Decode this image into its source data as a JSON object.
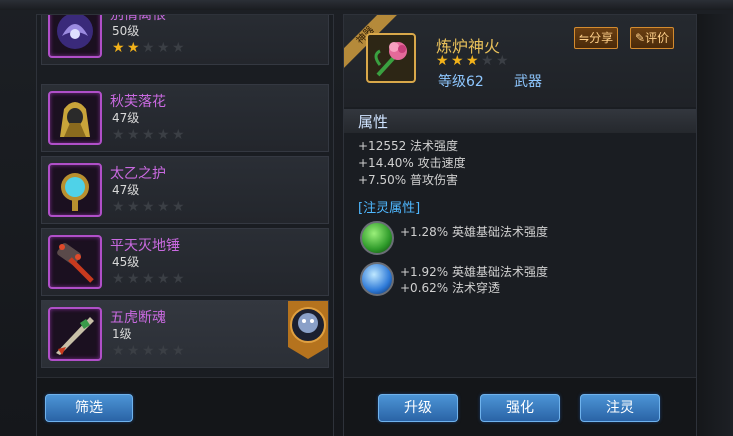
{
  "equipment_list": [
    {
      "name": "别情离恨",
      "level": "50级",
      "stars": 2,
      "icon": "purple-helmet-icon"
    },
    {
      "name": "秋芙落花",
      "level": "47级",
      "stars": 0,
      "icon": "gold-hood-icon"
    },
    {
      "name": "太乙之护",
      "level": "47级",
      "stars": 0,
      "icon": "magic-mirror-icon"
    },
    {
      "name": "平天灭地锤",
      "level": "45级",
      "stars": 0,
      "icon": "spiked-hammer-icon"
    },
    {
      "name": "五虎断魂",
      "level": "1级",
      "stars": 0,
      "icon": "tiger-blade-icon"
    }
  ],
  "filter_label": "筛选",
  "detail": {
    "corner_tag": "神器",
    "name": "炼炉神火",
    "stars": 3,
    "level": "等级62",
    "type": "武器",
    "share_label": "分享",
    "rate_label": "评价",
    "icon": "pink-flower-icon"
  },
  "attributes_header": "属性",
  "attributes": [
    "+12552 法术强度",
    "+14.40% 攻击速度",
    "+7.50% 普攻伤害"
  ],
  "spirit_header": "[注灵属性]",
  "spirit_slots": [
    {
      "gem": "green-gem-icon",
      "lines": [
        "+1.28% 英雄基础法术强度"
      ]
    },
    {
      "gem": "blue-gem-icon",
      "lines": [
        "+1.92% 英雄基础法术强度",
        "+0.62% 法术穿透"
      ]
    }
  ],
  "actions": {
    "upgrade": "升级",
    "enhance": "强化",
    "infuse": "注灵"
  },
  "colors": {
    "item_name": "#c96ae0",
    "star_on": "#f2b21a",
    "detail_name": "#e8c05a",
    "button_blue": "#3a7cc0"
  }
}
